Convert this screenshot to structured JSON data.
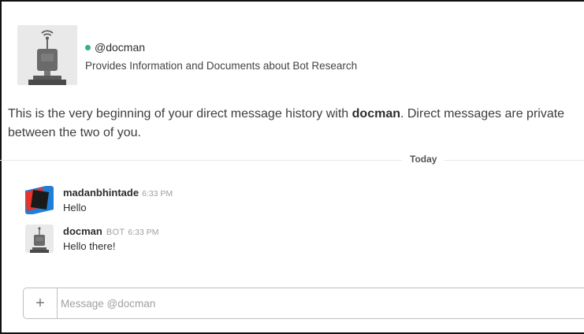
{
  "channel": {
    "handle": "@docman",
    "description": "Provides Information and Documents about Bot Research",
    "presence_color": "#2fb67c",
    "avatar_icon": "robot-icon"
  },
  "intro": {
    "prefix": "This is the very beginning of your direct message history with ",
    "bot_name": "docman",
    "suffix": ". Direct messages are private between the two of you."
  },
  "divider": {
    "label": "Today"
  },
  "messages": [
    {
      "sender": "madanbhintade",
      "badge": "",
      "time": "6:33 PM",
      "text": "Hello",
      "avatar_icon": "user-avatar-icon"
    },
    {
      "sender": "docman",
      "badge": "BOT",
      "time": "6:33 PM",
      "text": "Hello there!",
      "avatar_icon": "robot-icon"
    }
  ],
  "composer": {
    "plus_label": "+",
    "placeholder": "Message @docman"
  }
}
